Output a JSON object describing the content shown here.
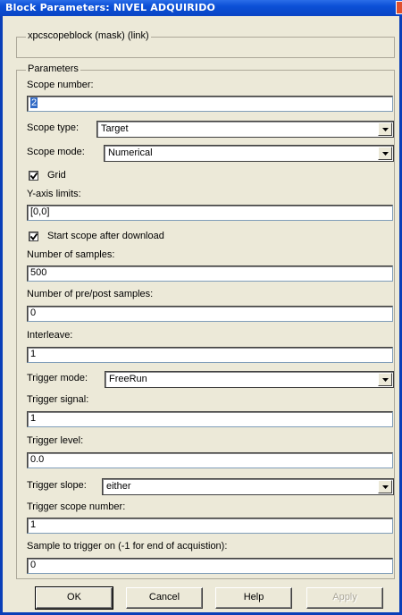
{
  "window": {
    "title": "Block Parameters: NIVEL ADQUIRIDO"
  },
  "mask": {
    "label": "xpcscopeblock (mask) (link)"
  },
  "parameters": {
    "label": "Parameters",
    "scope_number": {
      "label": "Scope number:",
      "value": "2"
    },
    "scope_type": {
      "label": "Scope type:",
      "value": "Target"
    },
    "scope_mode": {
      "label": "Scope mode:",
      "value": "Numerical"
    },
    "grid": {
      "label": "Grid",
      "checked": true
    },
    "y_axis_limits": {
      "label": "Y-axis limits:",
      "value": "[0,0]"
    },
    "start_scope": {
      "label": "Start scope after download",
      "checked": true
    },
    "num_samples": {
      "label": "Number of samples:",
      "value": "500"
    },
    "num_pre_post": {
      "label": "Number of pre/post samples:",
      "value": "0"
    },
    "interleave": {
      "label": "Interleave:",
      "value": "1"
    },
    "trigger_mode": {
      "label": "Trigger mode:",
      "value": "FreeRun"
    },
    "trigger_signal": {
      "label": "Trigger signal:",
      "value": "1"
    },
    "trigger_level": {
      "label": "Trigger level:",
      "value": "0.0"
    },
    "trigger_slope": {
      "label": "Trigger slope:",
      "value": "either"
    },
    "trigger_scope_number": {
      "label": "Trigger scope number:",
      "value": "1"
    },
    "sample_to_trigger": {
      "label": "Sample to trigger on (-1 for end of acquistion):",
      "value": "0"
    }
  },
  "buttons": {
    "ok": "OK",
    "cancel": "Cancel",
    "help": "Help",
    "apply": "Apply"
  },
  "colors": {
    "titlebar": "#0b4fd6",
    "dialog": "#ece9d8",
    "selection": "#316ac5"
  }
}
